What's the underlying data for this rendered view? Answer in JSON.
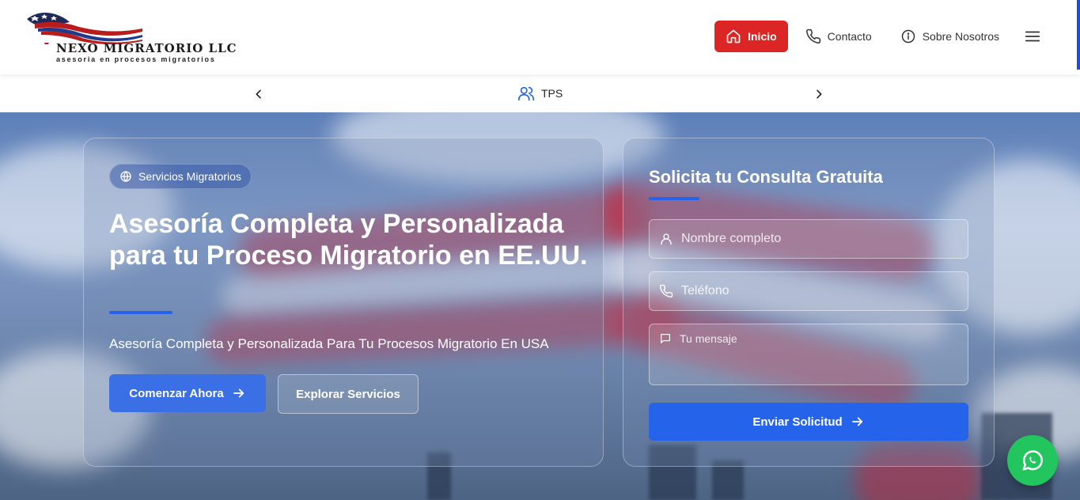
{
  "brand": {
    "name": "NEXO MIGRATORIO LLC",
    "tagline": "asesoria en procesos migratorios"
  },
  "nav": {
    "items": [
      {
        "label": "Inicio",
        "icon": "home-icon",
        "active": true
      },
      {
        "label": "Contacto",
        "icon": "phone-icon",
        "active": false
      },
      {
        "label": "Sobre Nosotros",
        "icon": "info-icon",
        "active": false
      }
    ],
    "menu_icon": "hamburger-menu-icon"
  },
  "subnav": {
    "current": "TPS",
    "icon": "users-icon"
  },
  "hero": {
    "badge": "Servicios Migratorios",
    "title": "Asesoría Completa y Personalizada para tu Proceso Migratorio en EE.UU.",
    "subtitle": "Asesoría Completa y Personalizada Para Tu Procesos Migratorio En USA",
    "primary_cta": "Comenzar Ahora",
    "secondary_cta": "Explorar Servicios"
  },
  "form": {
    "title": "Solicita tu Consulta Gratuita",
    "name_placeholder": "Nombre completo",
    "phone_placeholder": "Teléfono",
    "message_placeholder": "Tu mensaje",
    "submit": "Enviar Solicitud"
  },
  "colors": {
    "accent_red": "#dc2626",
    "primary_blue": "#2563eb",
    "whatsapp_green": "#22c55e"
  }
}
